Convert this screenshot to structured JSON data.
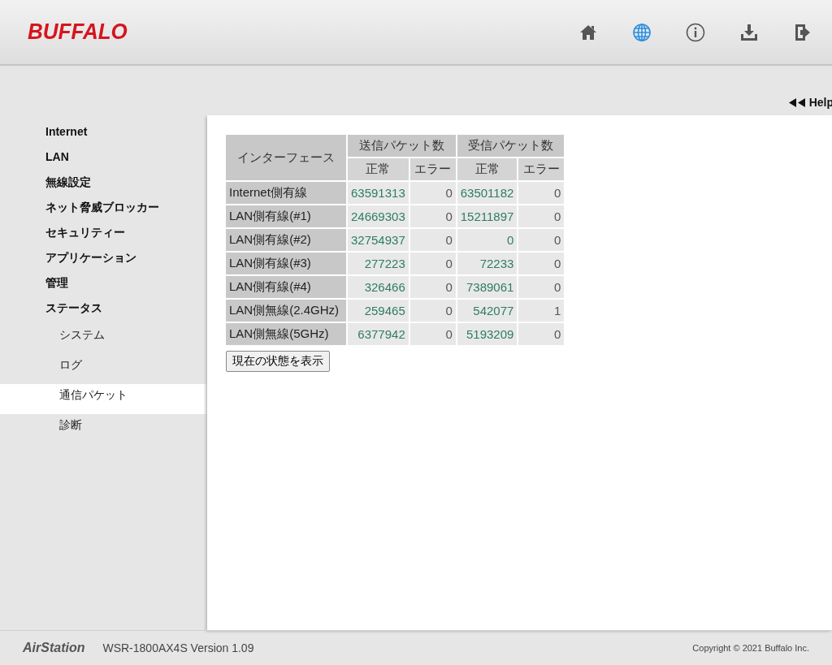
{
  "header": {
    "logo": "BUFFALO",
    "nav_icons": [
      {
        "kind": "home",
        "selected": false
      },
      {
        "kind": "globe",
        "selected": true
      },
      {
        "kind": "info",
        "selected": false
      },
      {
        "kind": "download",
        "selected": false
      },
      {
        "kind": "logout",
        "selected": false
      }
    ]
  },
  "help_link": "Help",
  "sidebar": {
    "items": [
      {
        "label": "Internet",
        "selected": false
      },
      {
        "label": "LAN",
        "selected": false
      },
      {
        "label": "無線設定",
        "selected": false
      },
      {
        "label": "ネット脅威ブロッカー",
        "selected": false
      },
      {
        "label": "セキュリティー",
        "selected": false
      },
      {
        "label": "アプリケーション",
        "selected": false
      },
      {
        "label": "管理",
        "selected": false
      },
      {
        "label": "ステータス",
        "selected": false,
        "children": [
          {
            "label": "システム",
            "selected": false
          },
          {
            "label": "ログ",
            "selected": false
          },
          {
            "label": "通信パケット",
            "selected": true
          },
          {
            "label": "診断",
            "selected": false
          }
        ]
      }
    ]
  },
  "table": {
    "interface_header": "インターフェース",
    "groups": [
      "送信パケット数",
      "受信パケット数"
    ],
    "subheaders": [
      "正常",
      "エラー",
      "正常",
      "エラー"
    ],
    "rows": [
      {
        "interface": "Internet側有線",
        "values": [
          "63591313",
          "0",
          "63501182",
          "0"
        ]
      },
      {
        "interface": "LAN側有線(#1)",
        "values": [
          "24669303",
          "0",
          "15211897",
          "0"
        ]
      },
      {
        "interface": "LAN側有線(#2)",
        "values": [
          "32754937",
          "0",
          "0",
          "0"
        ]
      },
      {
        "interface": "LAN側有線(#3)",
        "values": [
          "277223",
          "0",
          "72233",
          "0"
        ]
      },
      {
        "interface": "LAN側有線(#4)",
        "values": [
          "326466",
          "0",
          "7389061",
          "0"
        ]
      },
      {
        "interface": "LAN側無線(2.4GHz)",
        "values": [
          "259465",
          "0",
          "542077",
          "1"
        ]
      },
      {
        "interface": "LAN側無線(5GHz)",
        "values": [
          "6377942",
          "0",
          "5193209",
          "0"
        ]
      }
    ]
  },
  "refresh_button": "現在の状態を表示",
  "footer": {
    "product": "AirStation",
    "version": "WSR-1800AX4S Version 1.09",
    "copyright": "Copyright © 2021 Buffalo Inc."
  }
}
